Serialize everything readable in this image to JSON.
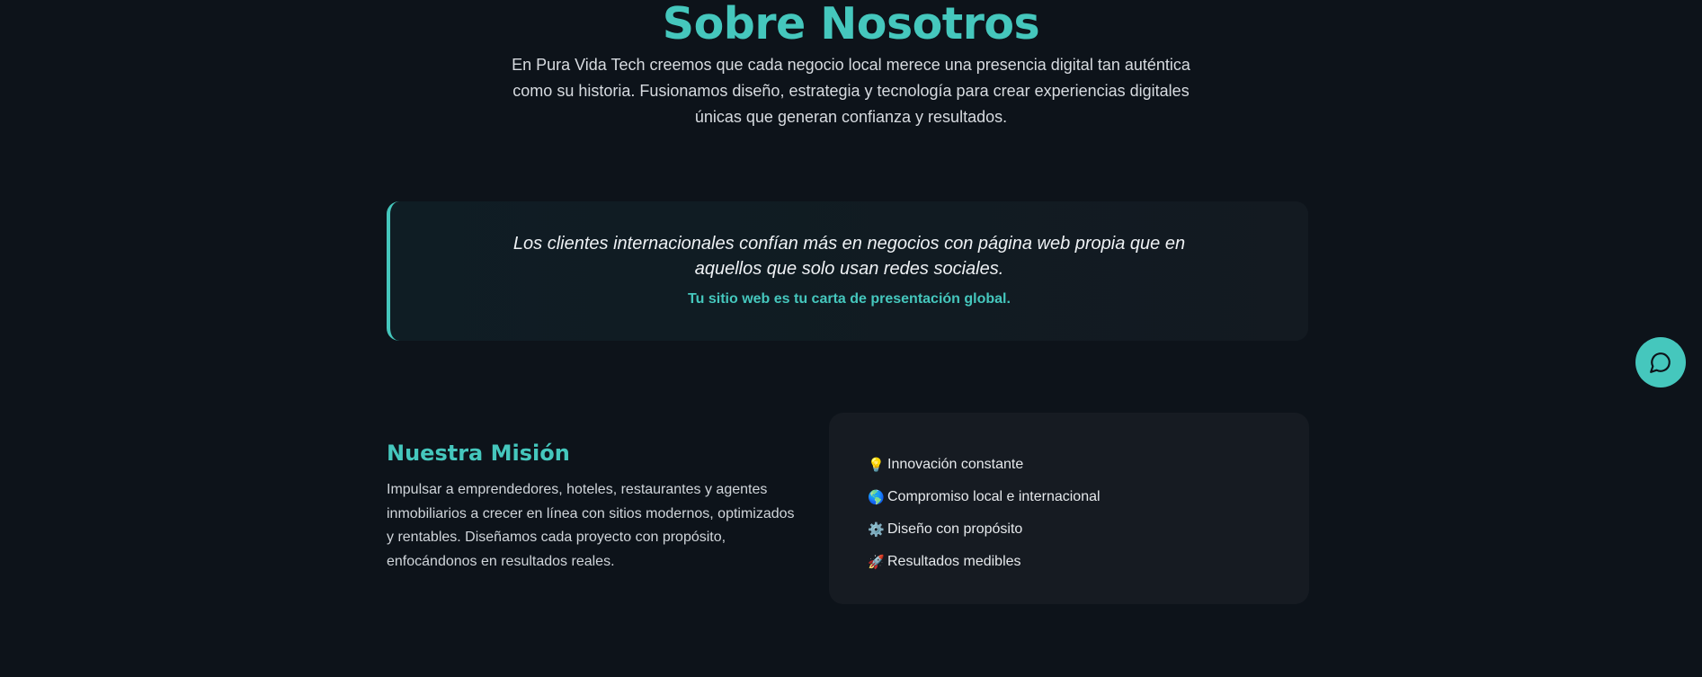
{
  "about": {
    "title": "Sobre Nosotros",
    "description": "En Pura Vida Tech creemos que cada negocio local merece una presencia digital tan auténtica como su historia. Fusionamos diseño, estrategia y tecnología para crear experiencias digitales únicas que generan confianza y resultados."
  },
  "quote": {
    "text": "Los clientes internacionales confían más en negocios con página web propia que en aquellos que solo usan redes sociales.",
    "tagline": "Tu sitio web es tu carta de presentación global."
  },
  "mission": {
    "title": "Nuestra Misión",
    "text": "Impulsar a emprendedores, hoteles, restaurantes y agentes inmobiliarios a crecer en línea con sitios modernos, optimizados y rentables. Diseñamos cada proyecto con propósito, enfocándonos en resultados reales."
  },
  "values": [
    {
      "icon": "lightbulb-icon",
      "glyph": "💡",
      "label": "Innovación constante"
    },
    {
      "icon": "globe-icon",
      "glyph": "🌎",
      "label": "Compromiso local e internacional"
    },
    {
      "icon": "gear-icon",
      "glyph": "⚙️",
      "label": "Diseño con propósito"
    },
    {
      "icon": "rocket-icon",
      "glyph": "🚀",
      "label": "Resultados medibles"
    }
  ],
  "chat": {
    "icon": "chat-bubble-icon"
  },
  "colors": {
    "accent": "#45c7bd",
    "background": "#0d131a",
    "card": "#161b22"
  }
}
